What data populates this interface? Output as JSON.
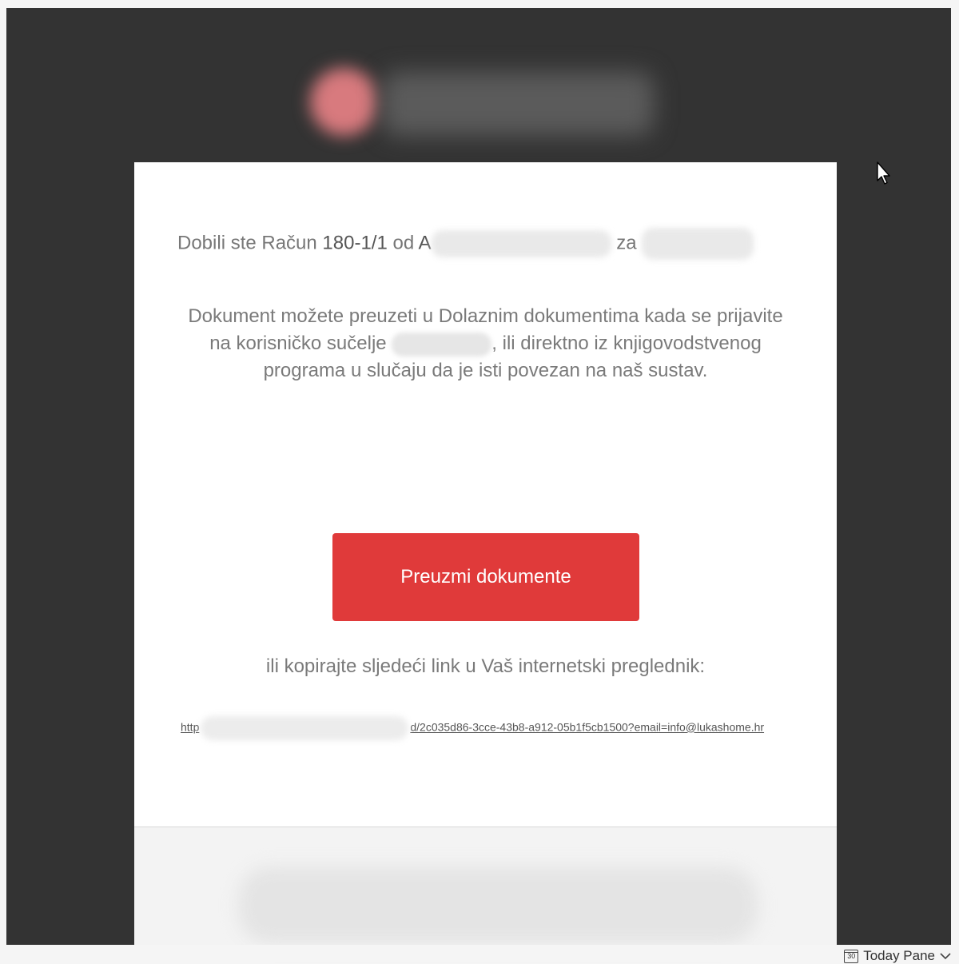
{
  "email": {
    "greeting_prefix": "Dobili ste Račun",
    "invoice_number": "180-1/1",
    "from_word": "od",
    "sender_initial": "A",
    "for_word": "za",
    "instructions_part1": "Dokument možete preuzeti u Dolaznim dokumentima kada se prijavite na korisničko sučelje",
    "instructions_part2": ", ili direktno iz knjigovodstvenog programa u slučaju da je isti povezan na naš sustav.",
    "cta_label": "Preuzmi dokumente",
    "copy_instruction": "ili kopirajte sljedeći link u Vaš internetski preglednik:",
    "link_prefix": "http",
    "link_suffix": "d/2c035d86-3cce-43b8-a912-05b1f5cb1500?email=info@lukashome.hr"
  },
  "status_bar": {
    "calendar_icon_day": "30",
    "today_pane_label": "Today Pane"
  },
  "colors": {
    "frame_bg": "#333333",
    "cta_bg": "#e03a3a",
    "card_bg": "#ffffff"
  },
  "icons": {
    "cursor": "arrow-cursor-icon",
    "calendar": "calendar-icon",
    "chevron": "chevron-down-icon"
  }
}
